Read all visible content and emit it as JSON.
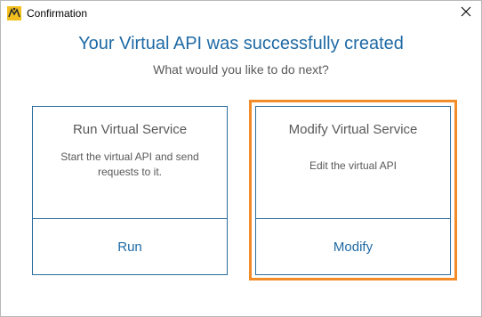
{
  "window": {
    "title": "Confirmation",
    "icon": "ready-api-app-icon",
    "close_icon": "close-icon"
  },
  "heading": "Your Virtual API was successfully created",
  "subheading": "What would you like to do next?",
  "options": [
    {
      "title": "Run Virtual Service",
      "description": "Start the virtual API and send requests to it.",
      "action": "Run"
    },
    {
      "title": "Modify Virtual Service",
      "description": "Edit the virtual API",
      "action": "Modify",
      "focused": true
    }
  ],
  "colors": {
    "heading": "#1f6aa5",
    "card_border": "#2c6e9e",
    "focus_border": "#f28c28",
    "muted_text": "#595959"
  }
}
